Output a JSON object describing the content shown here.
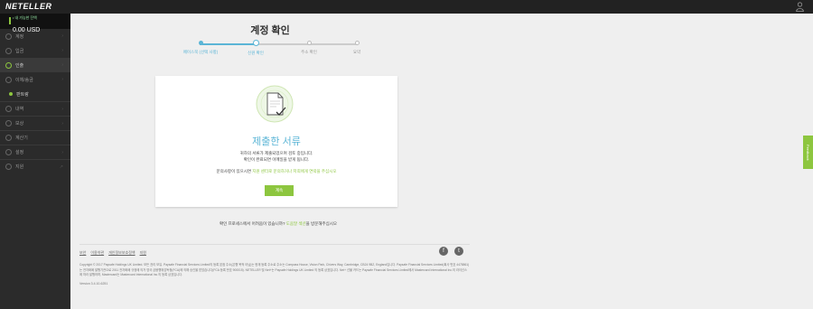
{
  "header": {
    "logo": "NETELLER"
  },
  "sidebar": {
    "balance_label": "• 내 가능한 잔액",
    "balance_amount": "0.00 USD",
    "items": [
      {
        "label": "계정"
      },
      {
        "label": "입금"
      },
      {
        "label": "인출"
      },
      {
        "label": "이체/송금"
      },
      {
        "label": "판트랑"
      },
      {
        "label": "내역"
      },
      {
        "label": "보상"
      },
      {
        "label": "계산기"
      },
      {
        "label": "설정"
      },
      {
        "label": "지원"
      }
    ]
  },
  "page": {
    "title": "계정 확인"
  },
  "steps": [
    {
      "label": "페이스북 (선택 사항)"
    },
    {
      "label": "신원 확인"
    },
    {
      "label": "주소 확인"
    },
    {
      "label": "요약"
    }
  ],
  "card": {
    "title": "제출한 서류",
    "message_1": "귀하의 서류가 제출되었으며 검토 중입니다.",
    "message_2": "확인이 완료되면 이메일을 받게 됩니다.",
    "help_prefix": "문의사항이 있으시면 ",
    "help_link": "지원 센터로 문의하거나 저희에게 연락을 주십시오",
    "ok_label": "계속"
  },
  "help": {
    "prefix": "확인 프로세스에서 어려움이 있습니까? ",
    "link": "도움말 섹션",
    "suffix": "을 방문해주십시오"
  },
  "footer": {
    "links": [
      "보안",
      "이용약관",
      "개인정보보호정책",
      "지원"
    ],
    "copyright": "Copyright © 2017 Paysafe Holdings UK Limited. 모든 권리 보유. Paysafe Financial Services Limited의 등록 본점 주소(은행 목적 아님)는 현재 등록 주소로 주소는 Compass House, Vision Park, Chivers Way, Cambridge, CB24 9BZ, England입니다. Paysafe Financial Services Limited(회사 번호 4478861)는 전자화폐 발행기관으로 2011 전자화폐 규정에 의거 영국 금융행위감독청(FCA)에 의해 승인을 받았습니다(FCA 등록 번호 900015). NETELLER 및 Net+는 Paysafe Holdings UK Limited 의 등록 상표입니다. Net+ 선불 카드는 Paysafe Financial Services Limited에서 Mastercard International Inc.의 라이선스에 따라 발행하며, Mastercard는 Mastercard International Inc.의 등록 상표입니다.",
    "version": "Version 3.4.10-6251"
  },
  "feedback_label": "Feedback",
  "colors": {
    "accent_green": "#8dc63f",
    "accent_blue": "#5bb5d6",
    "sidebar_bg": "#2b2b2b"
  }
}
